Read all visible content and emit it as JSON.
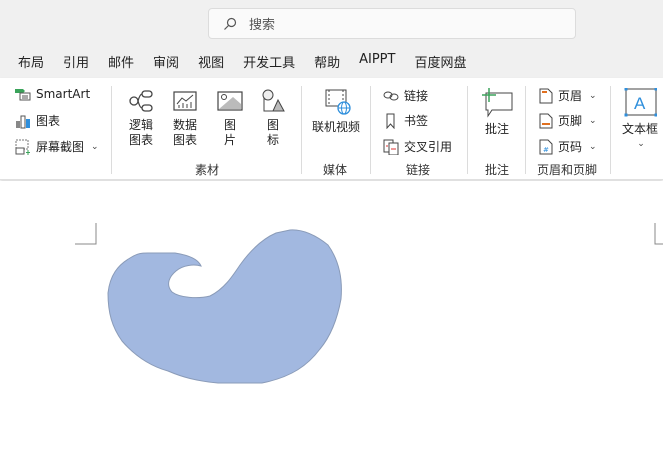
{
  "search": {
    "placeholder": "搜索"
  },
  "tabs": [
    "布局",
    "引用",
    "邮件",
    "审阅",
    "视图",
    "开发工具",
    "帮助",
    "AIPPT",
    "百度网盘"
  ],
  "ribbon": {
    "illustrations": {
      "smartart": "SmartArt",
      "chart": "图表",
      "screenshot": "屏幕截图"
    },
    "materials": {
      "logic_chart": [
        "逻辑",
        "图表"
      ],
      "data_chart": [
        "数据",
        "图表"
      ],
      "picture": [
        "图",
        "片"
      ],
      "icon": [
        "图",
        "标"
      ],
      "label": "素材"
    },
    "media": {
      "online_video": "联机视频",
      "label": "媒体"
    },
    "links": {
      "link": "链接",
      "bookmark": "书签",
      "cross_ref": "交叉引用",
      "label": "链接"
    },
    "comments": {
      "comment": "批注",
      "label": "批注"
    },
    "header_footer": {
      "header": "页眉",
      "footer": "页脚",
      "page_number": "页码",
      "label": "页眉和页脚"
    },
    "text": {
      "text_box": "文本框"
    }
  },
  "colors": {
    "shape_fill": "#a2b8e0",
    "shape_stroke": "#8a9bb8",
    "accent_blue": "#2f8fdc"
  }
}
